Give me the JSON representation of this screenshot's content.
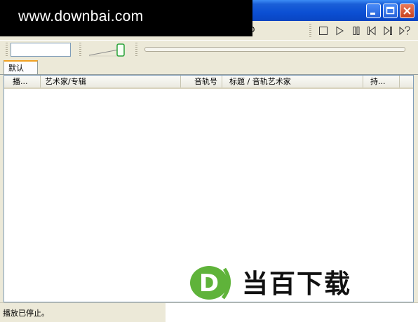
{
  "watermark": {
    "text": "www.downbai.com"
  },
  "menubar": {
    "partial_glyph": "D"
  },
  "toolbar": {
    "buttons": [
      {
        "name": "stop-icon"
      },
      {
        "name": "play-icon"
      },
      {
        "name": "pause-icon"
      },
      {
        "name": "previous-icon"
      },
      {
        "name": "next-icon"
      },
      {
        "name": "random-icon"
      }
    ]
  },
  "search": {
    "value": ""
  },
  "volume": {
    "level": 1.0
  },
  "seek": {
    "position": 0
  },
  "tabs": [
    {
      "label": "默认",
      "active": true
    }
  ],
  "playlist": {
    "columns": [
      {
        "label": "播..."
      },
      {
        "label": "艺术家/专辑"
      },
      {
        "label": "音轨号"
      },
      {
        "label": "标题 / 音轨艺术家"
      },
      {
        "label": "持..."
      }
    ],
    "rows": []
  },
  "status": {
    "text": "播放已停止。"
  },
  "logo": {
    "text": "当百下载",
    "letter": "D",
    "color": "#5fb33a"
  },
  "colors": {
    "titlebar": "#0b4fd3",
    "accent_tab": "#f0a020",
    "close_button": "#c7401c"
  }
}
